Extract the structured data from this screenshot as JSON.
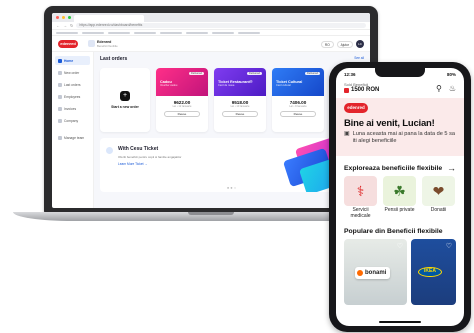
{
  "laptop": {
    "url": "https://app.edenred.ro/dashboard/benefits",
    "header": {
      "company_name": "Edenred",
      "company_sub": "Beneficii flexibile",
      "lang": "RO",
      "help": "Ajutor",
      "avatar": "LC"
    },
    "sidebar": {
      "items": [
        {
          "label": "Home",
          "active": true
        },
        {
          "label": "New order"
        },
        {
          "label": "Last orders"
        },
        {
          "label": "Employees"
        },
        {
          "label": "Invoices"
        },
        {
          "label": "Company"
        },
        {
          "label": "Manage team"
        }
      ]
    },
    "last_orders": {
      "title": "Last orders",
      "see_all": "See all",
      "new_order": "Start a new order",
      "orders": [
        {
          "name": "Cadou",
          "sub": "Voucher cadou",
          "badge": "Delivered",
          "amount": "9622.00",
          "meta": "Lei • 12 Ianuarie",
          "action": "Reuse"
        },
        {
          "name": "Ticket Restaurant®",
          "sub": "Card de masa",
          "badge": "Delivered",
          "amount": "9518.00",
          "meta": "Lei • 10 Ianuarie",
          "action": "Reuse"
        },
        {
          "name": "Ticket Cultural",
          "sub": "Card cultural",
          "badge": "Delivered",
          "amount": "7406.00",
          "meta": "Lei • 9 Ianuarie",
          "action": "Reuse"
        }
      ]
    },
    "promo": {
      "title": "With Cesu Ticket",
      "text": "Oferiti beneficii pentru copii si familie angajatilor",
      "link": "Learn More Ticket →"
    }
  },
  "phone": {
    "status_time": "12:36",
    "status_battery": "80%",
    "balance_label": "Sold Beneficii",
    "balance_value": "1500 RON",
    "logo": "edenred",
    "greeting": "Bine ai venit, Lucian!",
    "greeting_sub": "Luna aceasta mai ai pana la data de 5 sa iti alegi beneficiile",
    "explore_title": "Exploreaza beneficiile flexibile",
    "categories": [
      {
        "label": "Servicii medicale",
        "icon": "stethoscope-icon",
        "glyph": "⚕"
      },
      {
        "label": "Pensii private",
        "icon": "piggy-bank-icon",
        "glyph": "☘"
      },
      {
        "label": "Donatii",
        "icon": "donation-icon",
        "glyph": "❤"
      }
    ],
    "popular_title": "Populare din Beneficii flexibile",
    "benefits": [
      {
        "brand": "bonami"
      },
      {
        "brand": "IKEA"
      }
    ]
  }
}
